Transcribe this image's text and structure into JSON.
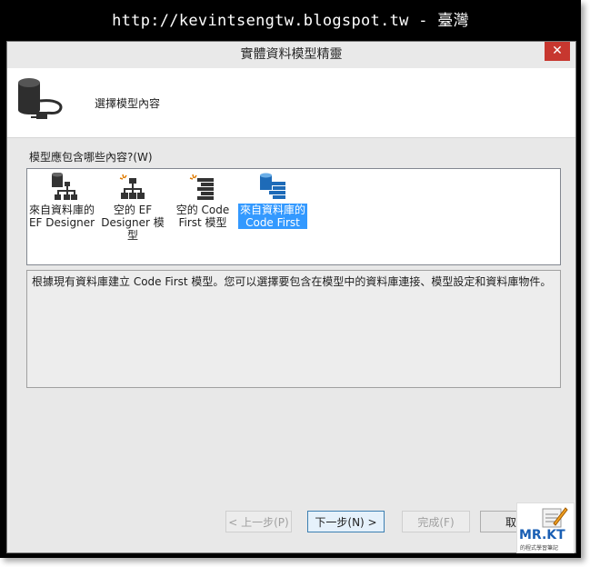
{
  "watermark": "http://kevintsengtw.blogspot.tw - 臺灣",
  "window": {
    "title": "實體資料模型精靈",
    "close_glyph": "✕"
  },
  "header": {
    "title": "選擇模型內容",
    "icon": "database-plug-icon"
  },
  "question_label": "模型應包含哪些內容?(W)",
  "templates": [
    {
      "label": "來自資料庫的 EF Designer",
      "icon": "database-hierarchy-icon",
      "selected": false
    },
    {
      "label": "空的 EF Designer 模型",
      "icon": "empty-hierarchy-icon",
      "selected": false
    },
    {
      "label": "空的 Code First 模型",
      "icon": "empty-code-first-icon",
      "selected": false
    },
    {
      "label": "來自資料庫的 Code First",
      "icon": "database-code-first-icon",
      "selected": true
    }
  ],
  "description": "根據現有資料庫建立 Code First 模型。您可以選擇要包含在模型中的資料庫連接、模型設定和資料庫物件。",
  "buttons": {
    "back": "< 上一步(P)",
    "next": "下一步(N) >",
    "finish": "完成(F)",
    "cancel": "取消"
  },
  "logo": {
    "text": "MR.KT",
    "sub": "的程式學習筆記"
  },
  "colors": {
    "selection": "#3399ff",
    "close_button": "#c7372f",
    "logo": "#1a5fb4"
  }
}
